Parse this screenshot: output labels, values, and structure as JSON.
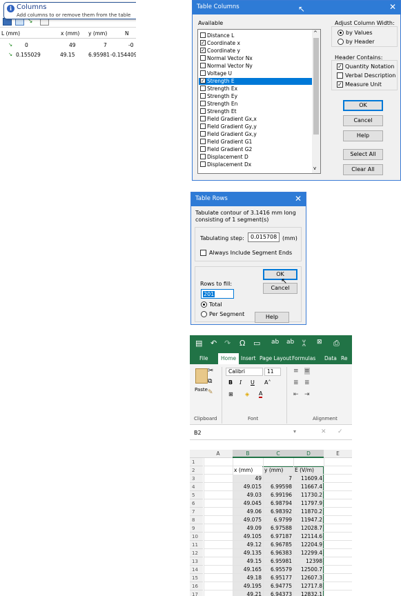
{
  "columns_panel": {
    "tooltip_title": "Columns",
    "tooltip_text": "Add columns to or remove them from the table",
    "headers": [
      "L (mm)",
      "x (mm)",
      "y (mm)",
      "N"
    ],
    "rows": [
      [
        "0",
        "49",
        "7",
        "-0"
      ],
      [
        "0.155029",
        "49.15",
        "6.95981",
        "-0.154409"
      ]
    ]
  },
  "table_columns": {
    "title": "Table Columns",
    "available_label": "Available",
    "items": [
      {
        "label": "Distance L",
        "checked": false
      },
      {
        "label": "Coordinate x",
        "checked": true
      },
      {
        "label": "Coordinate y",
        "checked": true
      },
      {
        "label": "Normal Vector Nx",
        "checked": false
      },
      {
        "label": "Normal Vector Ny",
        "checked": false
      },
      {
        "label": "Voltage U",
        "checked": false
      },
      {
        "label": "Strength E",
        "checked": true,
        "selected": true
      },
      {
        "label": "Strength Ex",
        "checked": false
      },
      {
        "label": "Strength Ey",
        "checked": false
      },
      {
        "label": "Strength En",
        "checked": false
      },
      {
        "label": "Strength Et",
        "checked": false
      },
      {
        "label": "Field Gradient Gx,x",
        "checked": false
      },
      {
        "label": "Field Gradient Gy,y",
        "checked": false
      },
      {
        "label": "Field Gradient Gx,y",
        "checked": false
      },
      {
        "label": "Field Gradient G1",
        "checked": false
      },
      {
        "label": "Field Gradient G2",
        "checked": false
      },
      {
        "label": "Displacement D",
        "checked": false
      },
      {
        "label": "Displacement Dx",
        "checked": false
      }
    ],
    "adjust_label": "Adjust Column Width:",
    "by_values": "by Values",
    "by_header": "by Header",
    "header_contains_label": "Header Contains:",
    "quantity_notation": "Quantity Notation",
    "verbal_description": "Verbal Description",
    "measure_unit": "Measure Unit",
    "ok": "OK",
    "cancel": "Cancel",
    "help": "Help",
    "select_all": "Select All",
    "clear_all": "Clear All"
  },
  "table_rows": {
    "title": "Table Rows",
    "description": "Tabulate contour of 3.1416 mm long consisting of 1 segment(s)",
    "step_label": "Tabulating step:",
    "step_value": "0.015708",
    "step_unit": "(mm)",
    "include_ends": "Always Include Segment Ends",
    "rows_to_fill_label": "Rows to fill:",
    "rows_value": "201",
    "total": "Total",
    "per_segment": "Per Segment",
    "ok": "OK",
    "cancel": "Cancel",
    "help": "Help"
  },
  "excel": {
    "tabs": [
      "File",
      "Home",
      "Insert",
      "Page Layout",
      "Formulas",
      "Data",
      "Re"
    ],
    "font_name": "Calibri",
    "font_size": "11",
    "paste": "Paste",
    "groups": [
      "Clipboard",
      "Font",
      "Alignment"
    ],
    "name_box": "B2",
    "col_headers": [
      "A",
      "B",
      "C",
      "D",
      "E"
    ],
    "header_row": [
      "x (mm)",
      "y (mm)",
      "E (V/m)"
    ],
    "rows": [
      [
        "49",
        "7",
        "11609.4"
      ],
      [
        "49.015",
        "6.99598",
        "11667.4"
      ],
      [
        "49.03",
        "6.99196",
        "11730.2"
      ],
      [
        "49.045",
        "6.98794",
        "11797.9"
      ],
      [
        "49.06",
        "6.98392",
        "11870.2"
      ],
      [
        "49.075",
        "6.9799",
        "11947.2"
      ],
      [
        "49.09",
        "6.97588",
        "12028.7"
      ],
      [
        "49.105",
        "6.97187",
        "12114.6"
      ],
      [
        "49.12",
        "6.96785",
        "12204.9"
      ],
      [
        "49.135",
        "6.96383",
        "12299.4"
      ],
      [
        "49.15",
        "6.95981",
        "12398"
      ],
      [
        "49.165",
        "6.95579",
        "12500.7"
      ],
      [
        "49.18",
        "6.95177",
        "12607.3"
      ],
      [
        "49.195",
        "6.94775",
        "12717.8"
      ],
      [
        "49.21",
        "6.94373",
        "12832.1"
      ]
    ]
  }
}
